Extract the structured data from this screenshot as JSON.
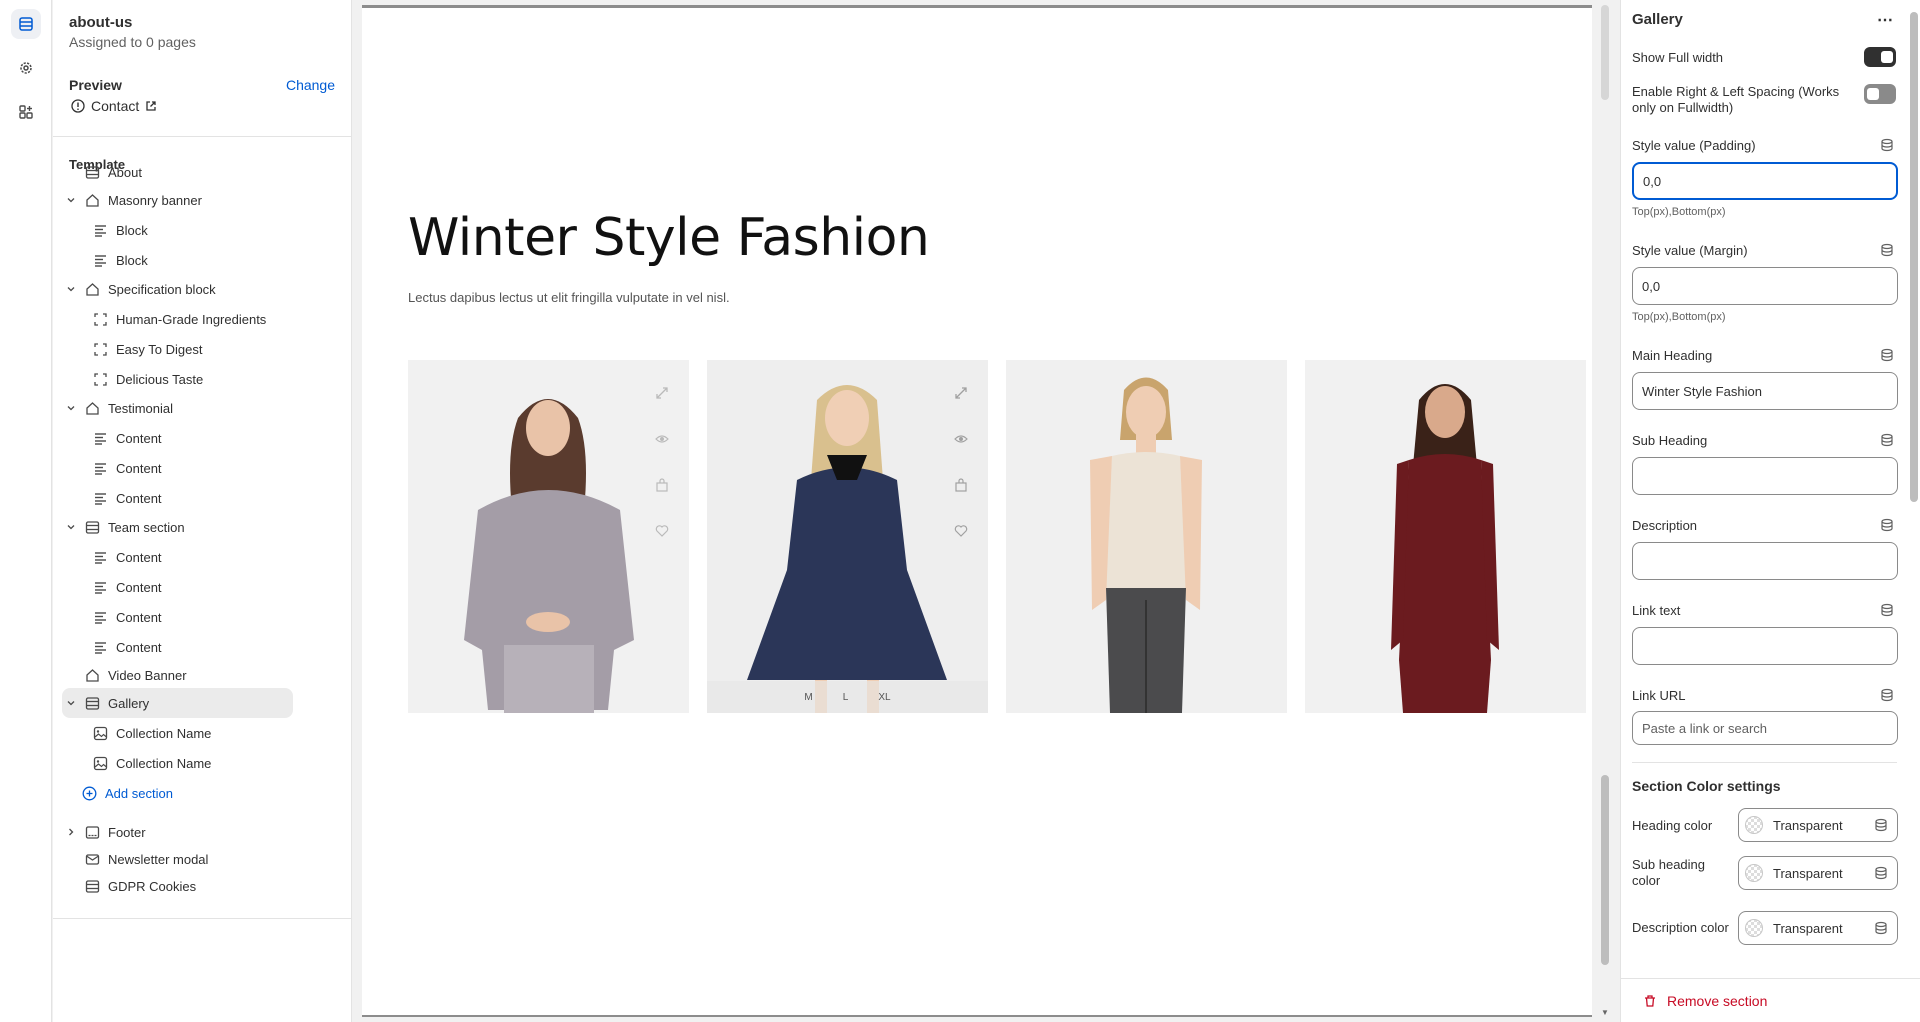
{
  "template": {
    "name": "about-us",
    "assigned": "Assigned to 0 pages",
    "preview_label": "Preview",
    "change_label": "Change",
    "preview_page": "Contact"
  },
  "tree": {
    "heading": "Template",
    "items": [
      {
        "label": "About",
        "level": 0,
        "chev": false,
        "icon": "section-icon"
      },
      {
        "label": "Masonry banner",
        "level": 0,
        "chev": true,
        "icon": "home-icon"
      },
      {
        "label": "Block",
        "level": 1,
        "icon": "text-icon"
      },
      {
        "label": "Block",
        "level": 1,
        "icon": "text-icon"
      },
      {
        "label": "Specification block",
        "level": 0,
        "chev": true,
        "icon": "home-icon"
      },
      {
        "label": "Human-Grade Ingredients",
        "level": 1,
        "icon": "frame-icon"
      },
      {
        "label": "Easy To Digest",
        "level": 1,
        "icon": "frame-icon"
      },
      {
        "label": "Delicious Taste",
        "level": 1,
        "icon": "frame-icon"
      },
      {
        "label": "Testimonial",
        "level": 0,
        "chev": true,
        "icon": "home-icon"
      },
      {
        "label": "Content",
        "level": 1,
        "icon": "text-icon"
      },
      {
        "label": "Content",
        "level": 1,
        "icon": "text-icon"
      },
      {
        "label": "Content",
        "level": 1,
        "icon": "text-icon"
      },
      {
        "label": "Team section",
        "level": 0,
        "chev": true,
        "icon": "section-icon"
      },
      {
        "label": "Content",
        "level": 1,
        "icon": "text-icon"
      },
      {
        "label": "Content",
        "level": 1,
        "icon": "text-icon"
      },
      {
        "label": "Content",
        "level": 1,
        "icon": "text-icon"
      },
      {
        "label": "Content",
        "level": 1,
        "icon": "text-icon"
      },
      {
        "label": "Video Banner",
        "level": 0,
        "chev": false,
        "icon": "home-icon"
      },
      {
        "label": "Gallery",
        "level": 0,
        "chev": true,
        "icon": "section-icon",
        "selected": true
      },
      {
        "label": "Collection Name",
        "level": 1,
        "icon": "image-icon"
      },
      {
        "label": "Collection Name",
        "level": 1,
        "icon": "image-icon"
      }
    ],
    "add_section": "Add section",
    "footer_items": [
      {
        "label": "Footer",
        "chev": true,
        "icon": "footer-icon"
      },
      {
        "label": "Newsletter modal",
        "chev": false,
        "icon": "modal-icon"
      },
      {
        "label": "GDPR Cookies",
        "chev": false,
        "icon": "section-icon"
      }
    ]
  },
  "canvas": {
    "title": "Winter Style Fashion",
    "description": "Lectus dapibus lectus ut elit fringilla vulputate in vel nisl.",
    "sizes": [
      "M",
      "L",
      "XL"
    ]
  },
  "settings": {
    "title": "Gallery",
    "show_full_width": "Show Full width",
    "show_full_width_on": true,
    "spacing_label": "Enable Right & Left Spacing (Works only on Fullwidth)",
    "spacing_on": false,
    "padding_label": "Style value (Padding)",
    "padding_value": "0,0",
    "padding_help": "Top(px),Bottom(px)",
    "margin_label": "Style value (Margin)",
    "margin_value": "0,0",
    "margin_help": "Top(px),Bottom(px)",
    "main_heading_label": "Main Heading",
    "main_heading_value": "Winter Style Fashion",
    "sub_heading_label": "Sub Heading",
    "sub_heading_value": "",
    "description_label": "Description",
    "description_value": "",
    "link_text_label": "Link text",
    "link_text_value": "",
    "link_url_label": "Link URL",
    "link_url_placeholder": "Paste a link or search",
    "color_section": "Section Color settings",
    "colors": [
      {
        "label": "Heading color",
        "value": "Transparent"
      },
      {
        "label": "Sub heading color",
        "value": "Transparent"
      },
      {
        "label": "Description color",
        "value": "Transparent"
      }
    ],
    "remove_label": "Remove section"
  }
}
